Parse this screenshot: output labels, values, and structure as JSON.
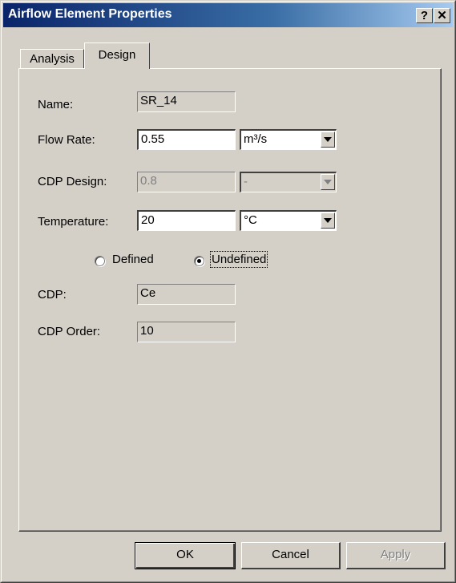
{
  "window": {
    "title": "Airflow Element Properties",
    "help_label": "?",
    "close_label": "✕"
  },
  "tabs": [
    {
      "label": "Analysis",
      "selected": false
    },
    {
      "label": "Design",
      "selected": true
    }
  ],
  "form": {
    "name": {
      "label": "Name:",
      "value": "SR_14"
    },
    "flow_rate": {
      "label": "Flow Rate:",
      "value": "0.55",
      "unit": "m³/s"
    },
    "cdp_design": {
      "label": "CDP Design:",
      "value": "0.8",
      "unit": "-"
    },
    "temperature": {
      "label": "Temperature:",
      "value": "20",
      "unit": "°C"
    },
    "radio": {
      "defined_label": "Defined",
      "undefined_label": "Undefined",
      "selected": "Undefined"
    },
    "cdp": {
      "label": "CDP:",
      "value": "Ce"
    },
    "cdp_order": {
      "label": "CDP Order:",
      "value": "10"
    }
  },
  "buttons": {
    "ok": "OK",
    "cancel": "Cancel",
    "apply": "Apply"
  },
  "colors": {
    "title_start": "#0a246a",
    "title_end": "#a6caf0",
    "face": "#d4d0c8"
  },
  "icons": {
    "dropdown": "chevron-down-icon"
  }
}
